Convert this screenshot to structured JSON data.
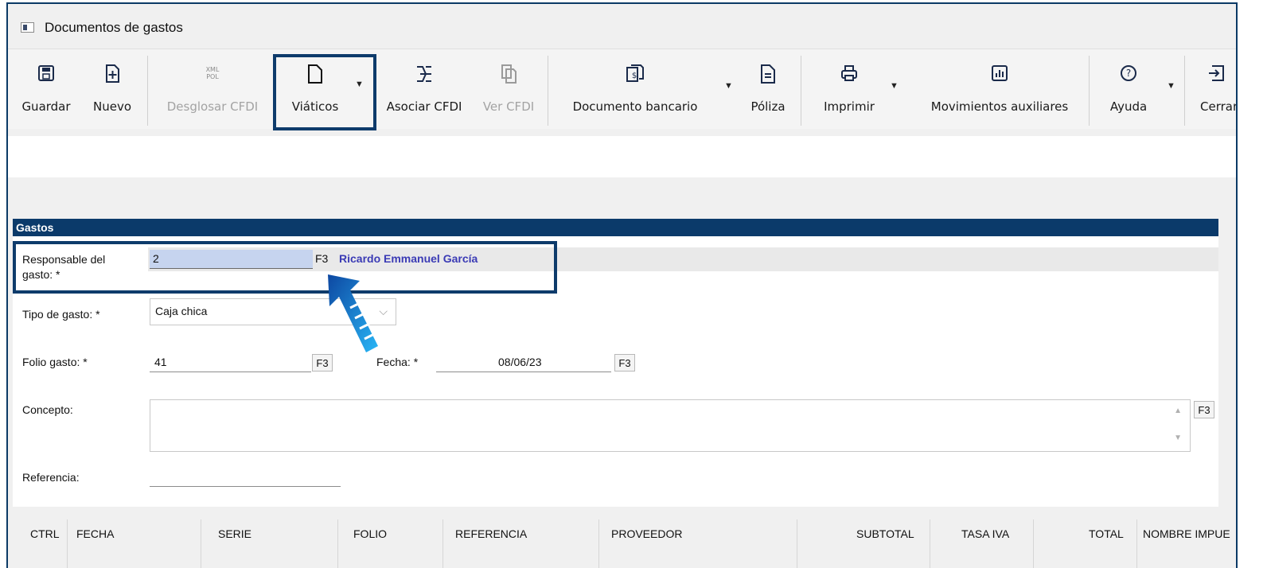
{
  "window": {
    "title": "Documentos de gastos"
  },
  "toolbar": {
    "items": [
      {
        "label": "Guardar",
        "icon": "save-icon",
        "enabled": true
      },
      {
        "label": "Nuevo",
        "icon": "new-doc-icon",
        "enabled": true
      },
      {
        "label": "Desglosar CFDI",
        "icon": "xml-pol-icon",
        "icon_text": "XML POL",
        "enabled": false
      },
      {
        "label": "Viáticos",
        "icon": "document-icon",
        "enabled": true
      },
      {
        "label": "Asociar CFDI",
        "icon": "link-icon",
        "enabled": true
      },
      {
        "label": "Ver CFDI",
        "icon": "copy-icon",
        "enabled": false
      },
      {
        "label": "Documento bancario",
        "icon": "bank-doc-icon",
        "enabled": true
      },
      {
        "label": "Póliza",
        "icon": "policy-icon",
        "enabled": true
      },
      {
        "label": "Imprimir",
        "icon": "printer-icon",
        "enabled": true
      },
      {
        "label": "Movimientos auxiliares",
        "icon": "chart-icon",
        "enabled": true
      },
      {
        "label": "Ayuda",
        "icon": "help-icon",
        "enabled": true
      },
      {
        "label": "Cerrar",
        "icon": "exit-icon",
        "enabled": true
      }
    ]
  },
  "section": {
    "title": "Gastos"
  },
  "form": {
    "responsable_label": "Responsable del gasto: *",
    "responsable_value": "2",
    "responsable_name": "Ricardo Emmanuel García",
    "tipo_label": "Tipo de gasto: *",
    "tipo_value": "Caja chica",
    "folio_label": "Folio gasto: *",
    "folio_value": "41",
    "fecha_label": "Fecha: *",
    "fecha_value": "08/06/23",
    "concepto_label": "Concepto:",
    "concepto_value": "",
    "referencia_label": "Referencia:",
    "referencia_value": "",
    "f3": "F3"
  },
  "table": {
    "columns": [
      "CTRL",
      "FECHA",
      "SERIE",
      "FOLIO",
      "REFERENCIA",
      "PROVEEDOR",
      "SUBTOTAL",
      "TASA IVA",
      "TOTAL",
      "NOMBRE IMPUE"
    ]
  },
  "colors": {
    "highlight": "#0e3b6b",
    "section_bar": "#0b3a6a",
    "arrow": "#1565c0",
    "name_text": "#3b3bb5"
  }
}
